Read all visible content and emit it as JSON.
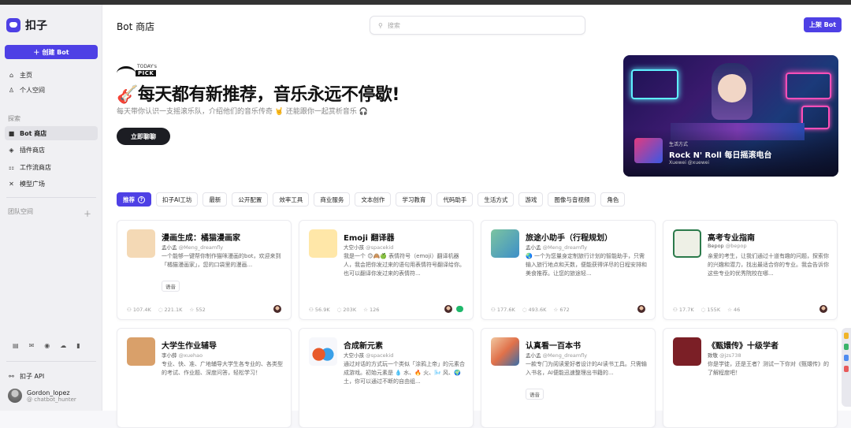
{
  "app": {
    "name": "扣子"
  },
  "sidebar": {
    "create_label": "创建 Bot",
    "items": [
      {
        "label": "主页",
        "icon": "home-icon"
      },
      {
        "label": "个人空间",
        "icon": "person-icon"
      }
    ],
    "explore_label": "探索",
    "explore_items": [
      {
        "label": "Bot 商店",
        "icon": "bot-icon",
        "active": true
      },
      {
        "label": "插件商店",
        "icon": "cube-icon"
      },
      {
        "label": "工作流商店",
        "icon": "workflow-icon"
      },
      {
        "label": "模型广场",
        "icon": "model-icon"
      }
    ],
    "team_label": "团队空间",
    "api_label": "扣子 API",
    "user": {
      "name": "Gordon_lopez",
      "handle": "@ chatbot_hunter"
    }
  },
  "header": {
    "title": "Bot 商店",
    "search_placeholder": "搜索",
    "publish_label": "上架 Bot"
  },
  "hero": {
    "badge_top": "TODAY's",
    "badge": "PICK",
    "title": "🎸每天都有新推荐，音乐永远不停歇!",
    "subtitle": "每天带你认识一支摇滚乐队，介绍他们的音乐传奇 🤘 还能跟你一起赏析音乐 🎧",
    "cta": "立即聊聊"
  },
  "banner": {
    "category": "生活方式",
    "name": "Rock N' Roll 每日摇滚电台",
    "author": "Xuewei @xuewei"
  },
  "tabs": [
    "推荐",
    "扣子AI工坊",
    "最新",
    "公开配置",
    "效率工具",
    "商业服务",
    "文本创作",
    "学习教育",
    "代码助手",
    "生活方式",
    "游戏",
    "图像与音视频",
    "角色"
  ],
  "cards": [
    {
      "title": "漫画生成：橘猫漫画家",
      "author": "孟小孟",
      "handle": "@Meng_dreamfly",
      "desc": "一个能够一键帮你制作猫咪漫画的bot，欢迎来到「橘猫漫画家」，您的口袋里的漫画...",
      "tag": "语音",
      "stats": [
        "107.4K",
        "221.1K",
        "552"
      ],
      "icon_color": "#f4d9b5"
    },
    {
      "title": "Emoji 翻译器",
      "author": "大空小孩",
      "handle": "@spacekid",
      "desc": "我是一个 😊🙈🍏 表情符号（emoji）翻译机器人，我会把你发过来的语句用表情符号翻译给你。也可以翻译你发过来的表情符...",
      "tag": "",
      "stats": [
        "56.9K",
        "203K",
        "126"
      ],
      "icon_color": "#ffe7a8"
    },
    {
      "title": "旅途小助手（行程规划）",
      "author": "孟小孟",
      "handle": "@Meng_dreamfly",
      "desc": "🌏 一个为您量身定制旅行计划的智能助手，只需输入旅行地点和天数，便能获得详尽的日程安排和美食推荐。让您的旅途轻...",
      "tag": "",
      "stats": [
        "177.6K",
        "493.6K",
        "672"
      ],
      "icon_color": "#7cc4a0"
    },
    {
      "title": "高考专业指南",
      "author": "Bepop",
      "handle": "@bepop",
      "desc": "亲爱的考生，让我们通过十道有趣的问题，探索你的兴趣和潜力，找出最适合你的专业。我会告诉你这些专业的优秀院校在哪...",
      "tag": "",
      "stats": [
        "17.7K",
        "155K",
        "46"
      ],
      "icon_color": "#eef0e6"
    },
    {
      "title": "大学生作业辅导",
      "author": "李小薛",
      "handle": "@xuehao",
      "desc": "专业、快、准、广地辅导大学生各专业的、各类型的考试、作业题、深度问答，轻松学习！",
      "tag": "",
      "stats": [],
      "icon_color": "#d9a06a"
    },
    {
      "title": "合成新元素",
      "author": "大空小孩",
      "handle": "@spacekid",
      "desc": "通过对话的方式玩一个类似「涂鸦上帝」的元素合成游戏。初始元素是 💧 水、🔥 火、🌬️ 风、🌍 土，你可以通过不断的自由组...",
      "tag": "",
      "stats": [],
      "icon_color": "#f6f7fb"
    },
    {
      "title": "认真看一百本书",
      "author": "孟小孟",
      "handle": "@Meng_dreamfly",
      "desc": "一款专门为阅读爱好者设计的AI读书工具。只需输入书名，AI便能迅速整理出书籍的...",
      "tag": "语音",
      "stats": [],
      "icon_color": "#f1c7a0"
    },
    {
      "title": "《甄嬛传》十级学者",
      "author": "致敬",
      "handle": "@jzs738",
      "desc": "你是学徒，还是王者？测试一下你对《甄嬛传》的了解程度吧！",
      "tag": "",
      "stats": [],
      "icon_color": "#7b1f26"
    }
  ],
  "colors": {
    "accent": "#4e40e5",
    "sidebar_bg": "#f0f0f3"
  }
}
